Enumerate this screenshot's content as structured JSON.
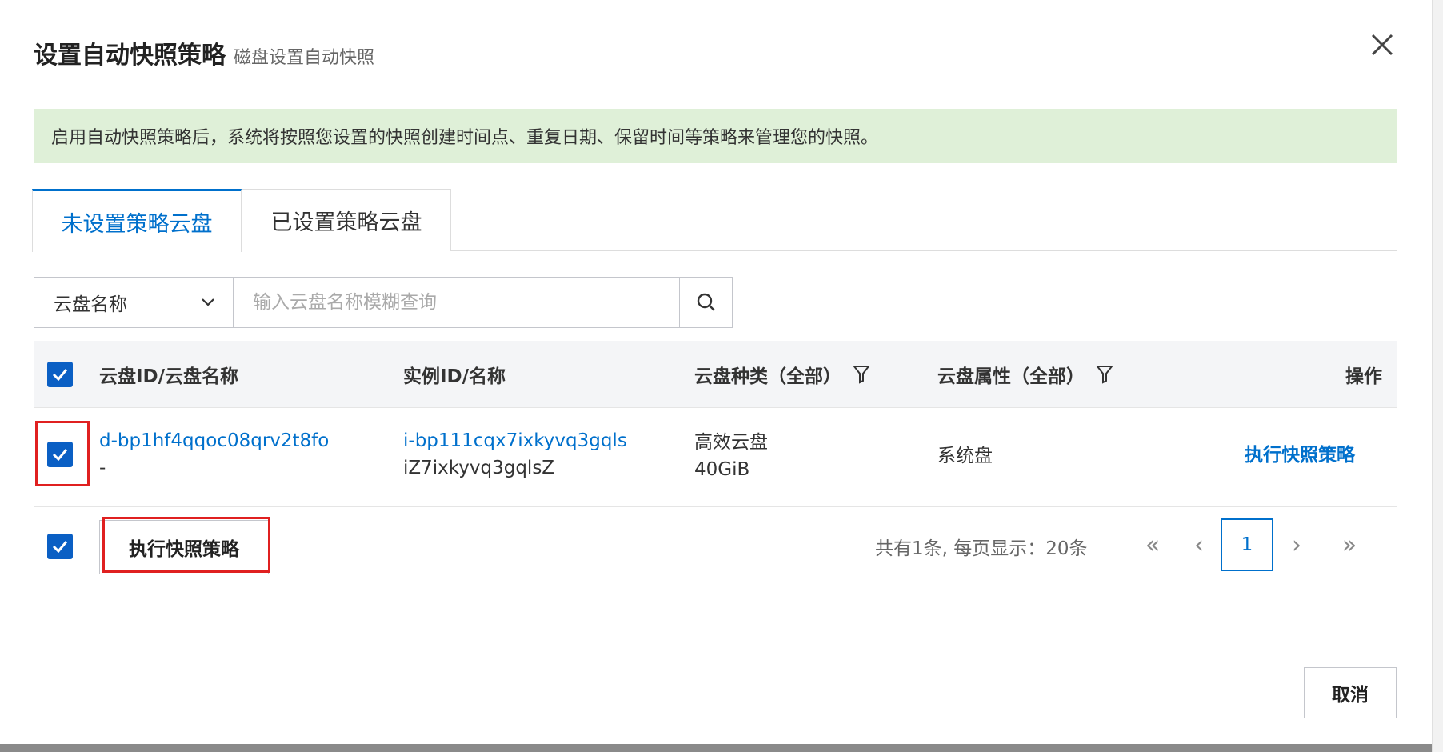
{
  "dialog": {
    "title": "设置自动快照策略",
    "subtitle": "磁盘设置自动快照",
    "close_icon": "close-icon",
    "notice": "启用自动快照策略后，系统将按照您设置的快照创建时间点、重复日期、保留时间等策略来管理您的快照。"
  },
  "tabs": [
    {
      "label": "未设置策略云盘",
      "active": true
    },
    {
      "label": "已设置策略云盘",
      "active": false
    }
  ],
  "search": {
    "select_value": "云盘名称",
    "placeholder": "输入云盘名称模糊查询"
  },
  "table": {
    "columns": [
      "云盘ID/云盘名称",
      "实例ID/名称",
      "云盘种类（全部）",
      "云盘属性（全部）",
      "操作"
    ],
    "rows": [
      {
        "disk_id": "d-bp1hf4qqoc08qrv2t8fo",
        "disk_name": "-",
        "instance_id": "i-bp111cqx7ixkyvq3gqls",
        "instance_name": "iZ7ixkyvq3gqlsZ",
        "disk_type": "高效云盘",
        "disk_size": "40GiB",
        "disk_attr": "系统盘",
        "action": "执行快照策略",
        "checked": true
      }
    ]
  },
  "footer": {
    "batch_button": "执行快照策略",
    "total_text": "共有1条, 每页显示：20条",
    "first_page": "«",
    "prev_page": "‹",
    "current_page": "1",
    "next_page": "›",
    "last_page": "»",
    "cancel_button": "取消"
  },
  "colors": {
    "accent": "#0070cc",
    "checkbox": "#0a5fc4",
    "notice_bg": "#dff0d8",
    "highlight": "#e02020"
  }
}
